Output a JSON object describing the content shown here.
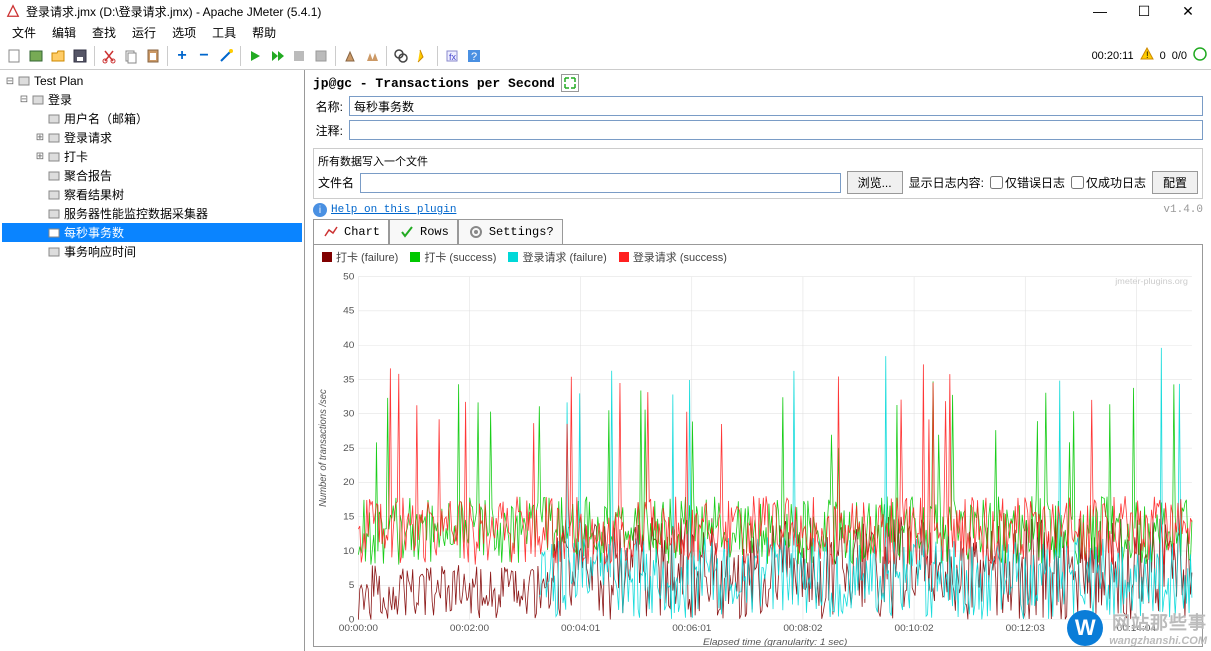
{
  "window": {
    "title": "登录请求.jmx (D:\\登录请求.jmx) - Apache JMeter (5.4.1)"
  },
  "menu": [
    "文件",
    "编辑",
    "查找",
    "运行",
    "选项",
    "工具",
    "帮助"
  ],
  "status": {
    "time": "00:20:11",
    "warn_count": "0",
    "run_ratio": "0/0"
  },
  "tree": [
    {
      "label": "Test Plan",
      "indent": 0,
      "expander": "⊟",
      "selected": false
    },
    {
      "label": "登录",
      "indent": 1,
      "expander": "⊟",
      "selected": false
    },
    {
      "label": "用户名（邮箱）",
      "indent": 2,
      "expander": "",
      "selected": false
    },
    {
      "label": "登录请求",
      "indent": 2,
      "expander": "⊞",
      "selected": false
    },
    {
      "label": "打卡",
      "indent": 2,
      "expander": "⊞",
      "selected": false
    },
    {
      "label": "聚合报告",
      "indent": 2,
      "expander": "",
      "selected": false
    },
    {
      "label": "察看结果树",
      "indent": 2,
      "expander": "",
      "selected": false
    },
    {
      "label": "服务器性能监控数据采集器",
      "indent": 2,
      "expander": "",
      "selected": false
    },
    {
      "label": "每秒事务数",
      "indent": 2,
      "expander": "",
      "selected": true
    },
    {
      "label": "事务响应时间",
      "indent": 2,
      "expander": "",
      "selected": false
    }
  ],
  "panel": {
    "title": "jp@gc - Transactions per Second",
    "name_label": "名称:",
    "name_value": "每秒事务数",
    "comment_label": "注释:",
    "comment_value": "",
    "file_section_title": "所有数据写入一个文件",
    "filename_label": "文件名",
    "filename_value": "",
    "browse_btn": "浏览...",
    "log_display_label": "显示日志内容:",
    "only_error_label": "仅错误日志",
    "only_success_label": "仅成功日志",
    "config_btn": "配置",
    "help_link": "Help on this plugin",
    "version": "v1.4.0"
  },
  "tabs": [
    {
      "label": "Chart",
      "icon": "chart",
      "active": true
    },
    {
      "label": "Rows",
      "icon": "check",
      "active": false
    },
    {
      "label": "Settings?",
      "icon": "gear",
      "active": false
    }
  ],
  "chart_data": {
    "type": "line",
    "title": "",
    "xlabel": "Elapsed time (granularity: 1 sec)",
    "ylabel": "Number of transactions /sec",
    "ylim": [
      0,
      50
    ],
    "y_ticks": [
      0,
      5,
      10,
      15,
      20,
      25,
      30,
      35,
      40,
      45,
      50
    ],
    "x_ticks": [
      "00:00:00",
      "00:02:00",
      "00:04:01",
      "00:06:01",
      "00:08:02",
      "00:10:02",
      "00:12:03",
      "00:14:04"
    ],
    "x_range_sec": [
      0,
      1200
    ],
    "watermark_text": "jmeter-plugins.org",
    "series": [
      {
        "name": "打卡 (failure)",
        "color": "#800000",
        "band": [
          0,
          8
        ],
        "band2": [
          0,
          15
        ],
        "cutover_x": 280
      },
      {
        "name": "打卡 (success)",
        "color": "#00c800",
        "band": [
          8,
          18
        ],
        "spikes": 25
      },
      {
        "name": "登录请求 (failure)",
        "color": "#00d8d8",
        "band": [
          0,
          12
        ],
        "start_x": 260,
        "spikes": 30
      },
      {
        "name": "登录请求 (success)",
        "color": "#ff2020",
        "band": [
          8,
          18
        ],
        "spikes": 28
      }
    ],
    "notes": "极其密集的每秒采样折线图，约1200个x点；红/绿系列在10-16区间波动并偶有20-28的尖峰；青色failure系列约4分钟后出现并在0-12波动有尖峰到30+；深红failure系列全程低位，后期在0-15波动；右端有少量36-41的极值尖峰"
  },
  "watermark": {
    "circle": "W",
    "cn": "网站那些事",
    "en": "wangzhanshi.COM"
  }
}
